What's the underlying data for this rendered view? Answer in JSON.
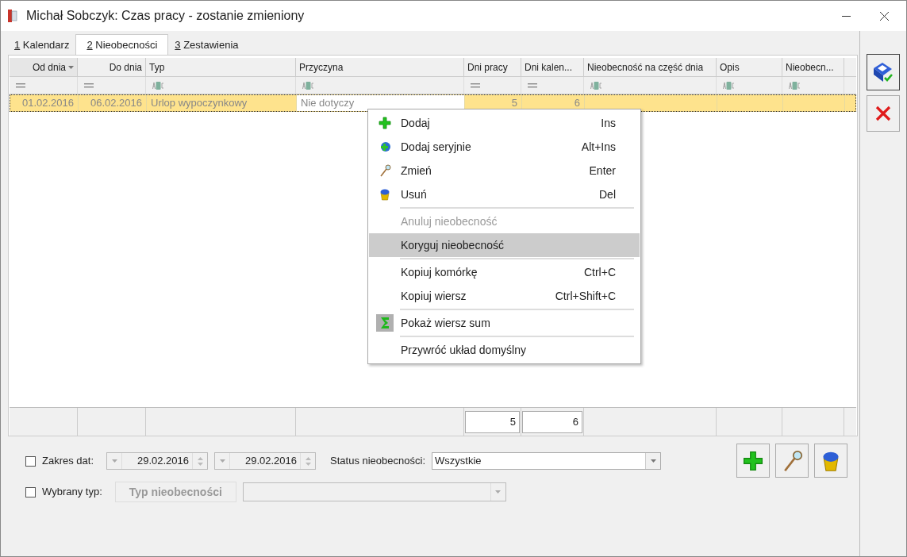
{
  "window": {
    "title": "Michał Sobczyk: Czas pracy - zostanie zmieniony"
  },
  "tabs": [
    {
      "key": "1",
      "label": "Kalendarz",
      "selected": false
    },
    {
      "key": "2",
      "label": "Nieobecności",
      "selected": true
    },
    {
      "key": "3",
      "label": "Zestawienia",
      "selected": false
    }
  ],
  "table": {
    "columns": [
      {
        "label": "Od dnia",
        "kind": "date",
        "sorted": true
      },
      {
        "label": "Do dnia",
        "kind": "date",
        "sorted": false
      },
      {
        "label": "Typ",
        "kind": "text",
        "sorted": false
      },
      {
        "label": "Przyczyna",
        "kind": "text",
        "sorted": false
      },
      {
        "label": "Dni pracy",
        "kind": "number",
        "sorted": false,
        "total": "5"
      },
      {
        "label": "Dni kalen...",
        "kind": "number",
        "sorted": false,
        "total": "6"
      },
      {
        "label": "Nieobecność na część dnia",
        "kind": "text",
        "sorted": false
      },
      {
        "label": "Opis",
        "kind": "text",
        "sorted": false
      },
      {
        "label": "Nieobecn...",
        "kind": "text",
        "sorted": false
      }
    ],
    "rows": [
      {
        "selected": true,
        "cells": [
          {
            "text": "01.02.2016",
            "focused": false
          },
          {
            "text": "06.02.2016",
            "focused": false
          },
          {
            "text": "Urlop wypoczynkowy",
            "focused": false
          },
          {
            "text": "Nie dotyczy",
            "focused": true
          },
          {
            "text": "5",
            "focused": false
          },
          {
            "text": "6",
            "focused": false
          },
          {
            "focused": false
          },
          {
            "focused": false
          },
          {
            "focused": false
          }
        ]
      }
    ]
  },
  "context_menu": [
    {
      "kind": "add",
      "label": "Dodaj",
      "shortcut": "Ins",
      "disabled": false,
      "selected": false
    },
    {
      "kind": "add-series",
      "label": "Dodaj seryjnie",
      "shortcut": "Alt+Ins",
      "disabled": false,
      "selected": false
    },
    {
      "kind": "edit",
      "label": "Zmień",
      "shortcut": "Enter",
      "disabled": false,
      "selected": false
    },
    {
      "kind": "delete",
      "label": "Usuń",
      "shortcut": "Del",
      "disabled": false,
      "selected": false
    },
    {
      "kind": "separator"
    },
    {
      "kind": "plain",
      "label": "Anuluj nieobecność",
      "disabled": true,
      "selected": false
    },
    {
      "kind": "plain",
      "label": "Koryguj nieobecność",
      "disabled": false,
      "selected": true
    },
    {
      "kind": "separator"
    },
    {
      "kind": "plain",
      "label": "Kopiuj komórkę",
      "shortcut": "Ctrl+C",
      "disabled": false,
      "selected": false
    },
    {
      "kind": "plain",
      "label": "Kopiuj wiersz",
      "shortcut": "Ctrl+Shift+C",
      "disabled": false,
      "selected": false
    },
    {
      "kind": "separator"
    },
    {
      "kind": "sum",
      "label": "Pokaż wiersz sum",
      "disabled": false,
      "selected": false
    },
    {
      "kind": "separator"
    },
    {
      "kind": "plain",
      "label": "Przywróć układ domyślny",
      "disabled": false,
      "selected": false
    }
  ],
  "filters": {
    "date_range": {
      "label": "Zakres dat:",
      "checked": false,
      "from": "29.02.2016",
      "to": "29.02.2016"
    },
    "status": {
      "label": "Status nieobecności:",
      "value": "Wszystkie"
    },
    "type": {
      "label": "Wybrany typ:",
      "checked": false,
      "button": "Typ nieobecności"
    }
  }
}
